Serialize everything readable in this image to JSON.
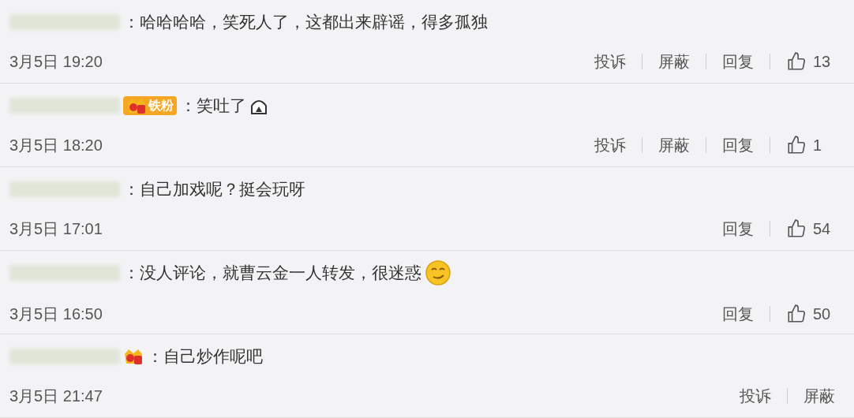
{
  "comments": [
    {
      "text": "：哈哈哈哈，笑死人了，这都出来辟谣，得多孤独",
      "date": "3月5日 19:20",
      "actions": [
        "投诉",
        "屏蔽",
        "回复"
      ],
      "likes": "13"
    },
    {
      "badge": {
        "kind": "fan",
        "label": "铁粉"
      },
      "text": "：笑吐了",
      "emoji": {
        "kind": "hiding"
      },
      "date": "3月5日 18:20",
      "actions": [
        "投诉",
        "屏蔽",
        "回复"
      ],
      "likes": "1"
    },
    {
      "text": "：自己加戏呢？挺会玩呀",
      "date": "3月5日 17:01",
      "actions": [
        "回复"
      ],
      "likes": "54"
    },
    {
      "text": "：没人评论，就曹云金一人转发，很迷惑",
      "emoji": {
        "kind": "smirk"
      },
      "date": "3月5日 16:50",
      "actions": [
        "回复"
      ],
      "likes": "50"
    },
    {
      "badge": {
        "kind": "crown"
      },
      "text": "：自己炒作呢吧",
      "date": "3月5日 21:47",
      "actions": [
        "投诉",
        "屏蔽"
      ]
    }
  ]
}
